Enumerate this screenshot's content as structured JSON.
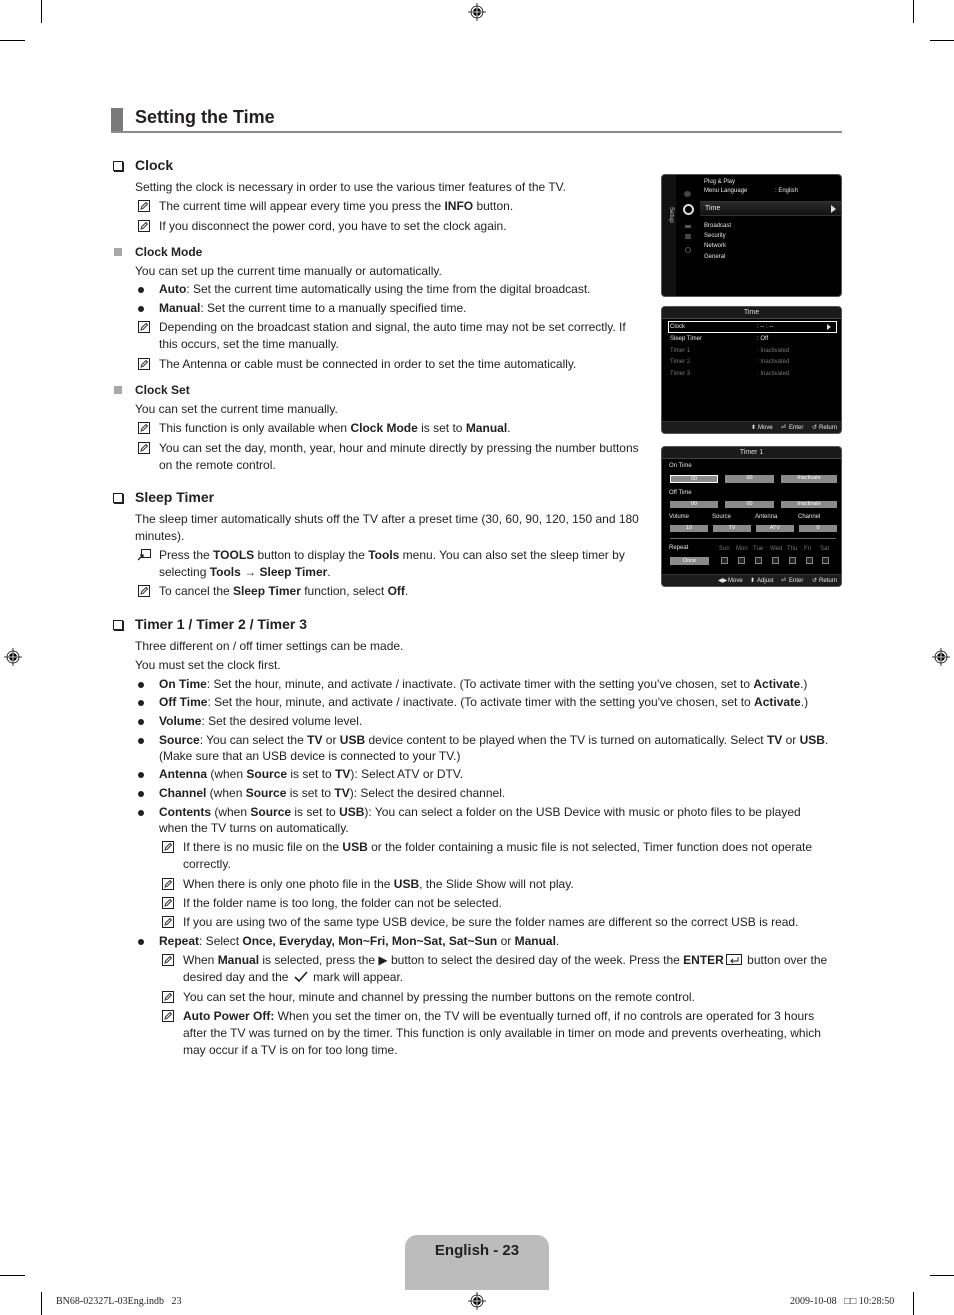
{
  "page_title": "Setting the Time",
  "sections": {
    "clock": {
      "heading": "Clock",
      "intro": "Setting the clock is necessary in order to use the various timer features of the TV.",
      "notes": [
        {
          "pre": "The current time will appear every time you press the ",
          "b1": "INFO",
          "post": " button."
        },
        {
          "text": "If you disconnect the power cord, you have to set the clock again."
        }
      ]
    },
    "clock_mode": {
      "heading": "Clock Mode",
      "intro": "You can set up the current time manually or automatically.",
      "bullets": [
        {
          "term": "Auto",
          "text": ": Set the current time automatically using the time from the digital broadcast."
        },
        {
          "term": "Manual",
          "text": ": Set the current time to a manually specified time."
        }
      ],
      "notes": [
        {
          "line1": "Depending on the broadcast station and signal, the auto time may not be set correctly. If",
          "line2": "this occurs, set the time manually."
        },
        {
          "line1": "The Antenna or cable must be connected in order to set the time automatically."
        }
      ]
    },
    "clock_set": {
      "heading": "Clock Set",
      "intro": "You can set the current time manually.",
      "notes": [
        {
          "pre": "This function is only available when ",
          "b1": "Clock Mode",
          "mid": " is set to ",
          "b2": "Manual",
          "post": "."
        },
        {
          "line1": "You can set the day, month, year, hour and minute directly by pressing the number buttons",
          "line2": "on the remote control."
        }
      ]
    },
    "sleep_timer": {
      "heading": "Sleep Timer",
      "intro_line1": "The sleep timer automatically shuts off the TV after a preset time (30, 60, 90, 120, 150 and 180",
      "intro_line2": "minutes).",
      "tools_note": {
        "pre": "Press the ",
        "b1": "TOOLS",
        "mid1": " button to display the ",
        "b2": "Tools",
        "mid2": " menu. You can also set the sleep timer by",
        "line2_pre": "selecting ",
        "b3": "Tools",
        "arrow": " → ",
        "b4": "Sleep Timer",
        "post": "."
      },
      "note": {
        "pre": "To cancel the ",
        "b1": "Sleep Timer",
        "mid": " function, select ",
        "b2": "Off",
        "post": "."
      }
    },
    "timers": {
      "heading": "Timer 1 / Timer 2 / Timer 3",
      "intro1": "Three different on / off timer settings can be made.",
      "intro2": "You must set the clock first.",
      "bullets": [
        {
          "term": "On Time",
          "text": ": Set the hour, minute, and activate / inactivate. (To activate timer with the setting you've chosen, set to ",
          "b": "Activate",
          "post": ".)"
        },
        {
          "term": "Off Time",
          "text": ": Set the hour, minute, and activate / inactivate. (To activate timer with the setting you've chosen, set to ",
          "b": "Activate",
          "post": ".)"
        },
        {
          "term": "Volume",
          "text": ": Set the desired volume level."
        },
        {
          "term": "Source",
          "text": ": You can select the ",
          "b1": "TV",
          "t2": " or ",
          "b2": "USB",
          "t3": " device content to be played when the TV is turned on automatically. Select ",
          "b3": "TV",
          "t4": " or ",
          "b4": "USB",
          "t5": ".",
          "line2": "(Make sure that an USB device is connected to your TV.)"
        },
        {
          "term": "Antenna",
          "text": " (when ",
          "b1": "Source",
          "t2": " is set to ",
          "b2": "TV",
          "t3": "): Select ATV or DTV."
        },
        {
          "term": "Channel",
          "text": " (when ",
          "b1": "Source",
          "t2": " is set to ",
          "b2": "TV",
          "t3": "): Select the desired channel."
        },
        {
          "term": "Contents",
          "text": " (when ",
          "b1": "Source",
          "t2": " is set to ",
          "b2": "USB",
          "t3": "): You can select a folder on the USB Device with music or photo files to be played",
          "line2": "when the TV turns on automatically."
        },
        {
          "term": "Repeat",
          "text": ": Select ",
          "b1": "Once, Everyday, Mon~Fri, Mon~Sat, Sat~Sun",
          "t2": " or ",
          "b2": "Manual",
          "t3": "."
        }
      ],
      "contents_notes": [
        {
          "pre": "If there is no music file on the ",
          "b1": "USB",
          "post": " or the folder containing a music file is not selected, Timer function does not operate",
          "line2": "correctly."
        },
        {
          "pre": "When there is only one photo file in the ",
          "b1": "USB",
          "post": ", the Slide Show will not play."
        },
        {
          "pre": "If the folder name is too long, the folder can not be selected."
        },
        {
          "pre": "If you are using two of the same type USB device, be sure the folder names are different so the correct USB is read."
        }
      ],
      "repeat_notes": [
        {
          "pre": "When ",
          "b1": "Manual",
          "mid": " is selected, press the ▶ button to select the desired day of the week. Press the ",
          "b2": "ENTER",
          "post": " button over the",
          "line2_pre": "desired day and the ",
          "line2_post": " mark will appear."
        },
        {
          "pre": "You can set the hour, minute and channel by pressing the number buttons on the remote control."
        },
        {
          "b1": "Auto Power Off:",
          "pre": " When you set the timer on, the TV will be eventually turned off, if no controls are operated for 3 hours",
          "line2": "after the TV was turned on by the timer. This function is only available in timer on mode and prevents overheating, which",
          "line3": "may occur if a TV is on for too long time."
        }
      ]
    }
  },
  "screens": {
    "setup": {
      "side_label": "Setup",
      "items": [
        {
          "label": "Plug & Play"
        },
        {
          "label": "Menu Language",
          "value": ": English"
        },
        {
          "label": "Time",
          "selected": true
        },
        {
          "label": "Broadcast"
        },
        {
          "label": "Security"
        },
        {
          "label": "Network"
        },
        {
          "label": "General"
        }
      ]
    },
    "time": {
      "title": "Time",
      "rows": [
        {
          "label": "Clock",
          "value": ": -- : --",
          "selected": true
        },
        {
          "label": "Sleep Timer",
          "value": ": Off"
        },
        {
          "label": "Timer 1",
          "value": ": Inactivated",
          "disabled": true
        },
        {
          "label": "Timer 2",
          "value": ": Inactivated",
          "disabled": true
        },
        {
          "label": "Timer 3",
          "value": ": Inactivated",
          "disabled": true
        }
      ],
      "footer": {
        "move": "Move",
        "enter": "Enter",
        "return": "Return"
      }
    },
    "timer1": {
      "title": "Timer 1",
      "on_time_label": "On Time",
      "on_time": [
        "00",
        "00",
        "Inactivate"
      ],
      "off_time_label": "Off Time",
      "off_time": [
        "00",
        "00",
        "Inactivate"
      ],
      "field_labels": [
        "Volume",
        "Source",
        "Antenna",
        "Channel"
      ],
      "field_values": [
        "10",
        "TV",
        "ATV",
        "0"
      ],
      "repeat_label": "Repeat",
      "repeat_value": "Once",
      "days": [
        "Sun",
        "Mon",
        "Tue",
        "Wed",
        "Thu",
        "Fri",
        "Sat"
      ],
      "footer": {
        "move": "Move",
        "adjust": "Adjust",
        "enter": "Enter",
        "return": "Return"
      }
    }
  },
  "footer": {
    "page_label": "English - 23",
    "slug_left": "BN68-02327L-03Eng.indb   23",
    "slug_right": "2009-10-08   □□ 10:28:50"
  }
}
